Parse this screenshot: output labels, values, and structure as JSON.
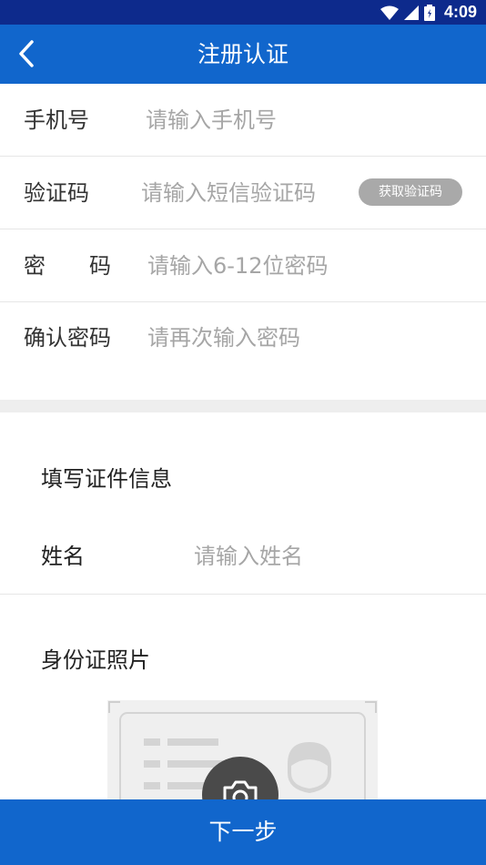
{
  "status_bar": {
    "time": "4:09",
    "icons": [
      "wifi-icon",
      "signal-icon",
      "battery-icon"
    ]
  },
  "header": {
    "title": "注册认证",
    "back_icon": "chevron-left-icon"
  },
  "form": {
    "phone": {
      "label": "手机号",
      "placeholder": "请输入手机号"
    },
    "code": {
      "label": "验证码",
      "placeholder": "请输入短信验证码",
      "button": "获取验证码"
    },
    "password": {
      "label": "密码",
      "placeholder": "请输入6-12位密码"
    },
    "confirm": {
      "label": "确认密码",
      "placeholder": "请再次输入密码"
    }
  },
  "id_section": {
    "title": "填写证件信息",
    "name": {
      "label": "姓名",
      "placeholder": "请输入姓名"
    },
    "photo_title": "身份证照片",
    "photo_icon": "camera-icon"
  },
  "footer": {
    "next_label": "下一步"
  },
  "colors": {
    "primary": "#1166cc",
    "status_bar": "#0d2a8c",
    "placeholder": "#a6a6a6",
    "button_gray": "#a9a9a9"
  }
}
